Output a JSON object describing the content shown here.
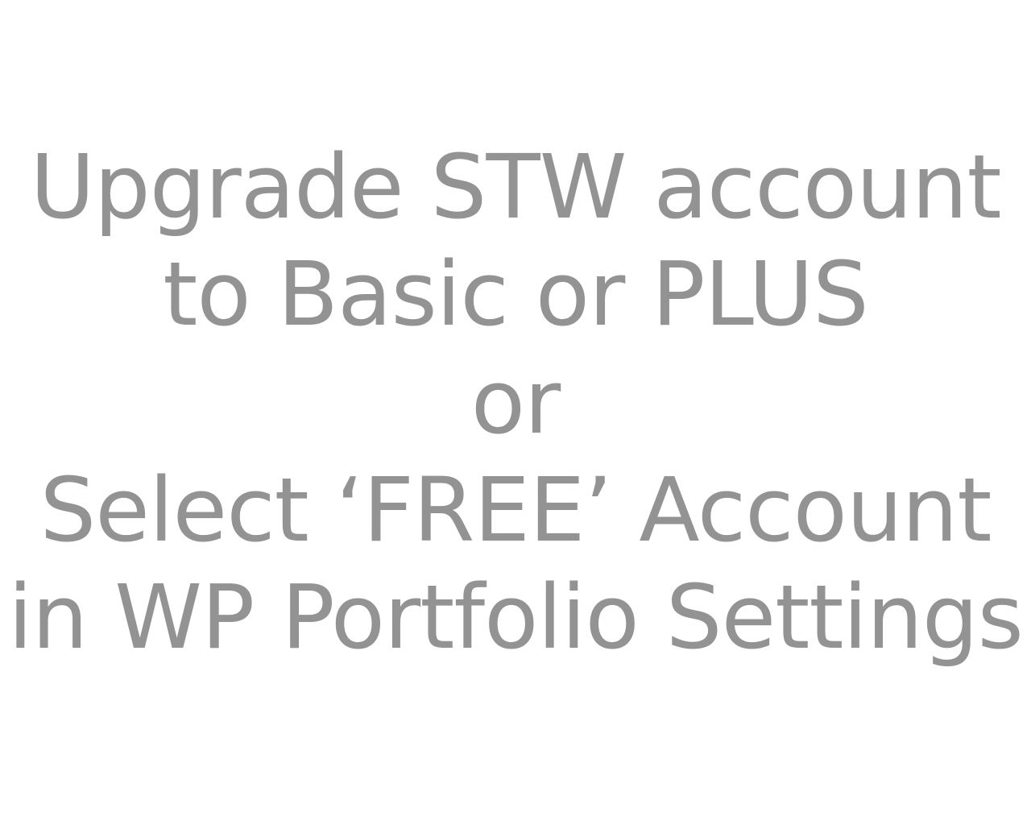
{
  "message": {
    "lines": [
      "Upgrade STW account",
      "to Basic or PLUS",
      "or",
      "Select ‘FREE’ Account",
      "in WP Portfolio Settings"
    ]
  },
  "colors": {
    "background": "#ffffff",
    "text": "#939393"
  }
}
